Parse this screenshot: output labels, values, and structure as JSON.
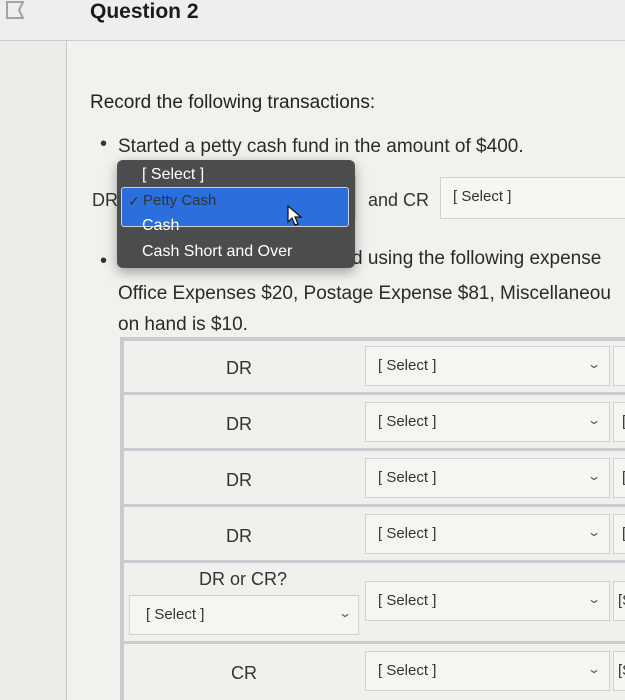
{
  "question": {
    "title": "Question 2",
    "instruction": "Record the following transactions:",
    "bullet1": {
      "prefix_visible": "Started a petty cash fund in the amount of $400.",
      "dr_label": "DR",
      "and_cr_label": "and CR",
      "cr_select_value": "[ Select ]"
    },
    "bullet2": {
      "line1_visible": "d using the following expense",
      "line2_visible": "Office Expenses $20, Postage Expense $81, Miscellaneou",
      "line3": "on hand is $10."
    }
  },
  "dropdown": {
    "placeholder": "[ Select ]",
    "options": [
      "Petty Cash",
      "Cash",
      "Cash Short and Over"
    ],
    "selected": "Petty Cash",
    "check": "✓"
  },
  "table": {
    "rows": [
      {
        "label": "DR",
        "select": "[ Select ]",
        "edge": ""
      },
      {
        "label": "DR",
        "select": "[ Select ]",
        "edge": "["
      },
      {
        "label": "DR",
        "select": "[ Select ]",
        "edge": "["
      },
      {
        "label": "DR",
        "select": "[ Select ]",
        "edge": "["
      },
      {
        "label": "DR or CR?",
        "left_select": "[ Select ]",
        "select": "[ Select ]",
        "edge": "[S"
      },
      {
        "label": "CR",
        "select": "[ Select ]",
        "edge": "[S"
      }
    ]
  },
  "icons": {
    "chevron": "⌄",
    "flag": "flag-icon",
    "cursor": "mouse-pointer-icon"
  }
}
